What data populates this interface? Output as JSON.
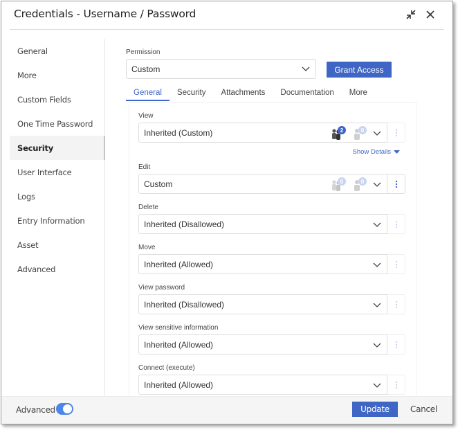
{
  "window": {
    "title": "Credentials - Username / Password",
    "collapse_icon": "collapse-arrows-icon",
    "close_icon": "close-icon"
  },
  "sidebar": {
    "items": [
      {
        "label": "General",
        "active": false
      },
      {
        "label": "More",
        "active": false
      },
      {
        "label": "Custom Fields",
        "active": false
      },
      {
        "label": "One Time Password",
        "active": false
      },
      {
        "label": "Security",
        "active": true
      },
      {
        "label": "User Interface",
        "active": false
      },
      {
        "label": "Logs",
        "active": false
      },
      {
        "label": "Entry Information",
        "active": false
      },
      {
        "label": "Asset",
        "active": false
      },
      {
        "label": "Advanced",
        "active": false
      }
    ]
  },
  "permission": {
    "label": "Permission",
    "value": "Custom",
    "grant_label": "Grant Access"
  },
  "tabs": [
    {
      "label": "General",
      "active": true
    },
    {
      "label": "Security",
      "active": false
    },
    {
      "label": "Attachments",
      "active": false
    },
    {
      "label": "Documentation",
      "active": false
    },
    {
      "label": "More",
      "active": false
    }
  ],
  "fields": [
    {
      "label": "View",
      "value": "Inherited (Custom)",
      "users_count": "2",
      "roles_count": "0",
      "show_details": "Show Details"
    },
    {
      "label": "Edit",
      "value": "Custom",
      "users_count": "0",
      "roles_count": "0"
    },
    {
      "label": "Delete",
      "value": "Inherited (Disallowed)"
    },
    {
      "label": "Move",
      "value": "Inherited (Allowed)"
    },
    {
      "label": "View password",
      "value": "Inherited (Disallowed)"
    },
    {
      "label": "View sensitive information",
      "value": "Inherited (Allowed)"
    },
    {
      "label": "Connect (execute)",
      "value": "Inherited (Allowed)"
    }
  ],
  "footer": {
    "advanced_label": "Advanced",
    "advanced_on": true,
    "update_label": "Update",
    "cancel_label": "Cancel"
  },
  "colors": {
    "accent": "#3f66c5",
    "toggle": "#4b86e8",
    "badge_inactive": "#c9d4ef"
  }
}
